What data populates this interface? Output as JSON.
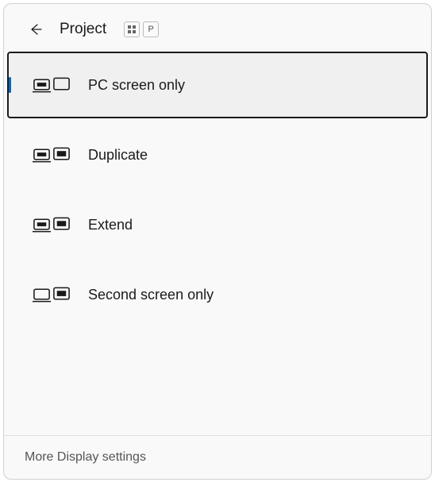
{
  "header": {
    "title": "Project",
    "shortcut_key": "P"
  },
  "options": [
    {
      "label": "PC screen only",
      "selected": true
    },
    {
      "label": "Duplicate",
      "selected": false
    },
    {
      "label": "Extend",
      "selected": false
    },
    {
      "label": "Second screen only",
      "selected": false
    }
  ],
  "footer": {
    "link": "More Display settings"
  }
}
